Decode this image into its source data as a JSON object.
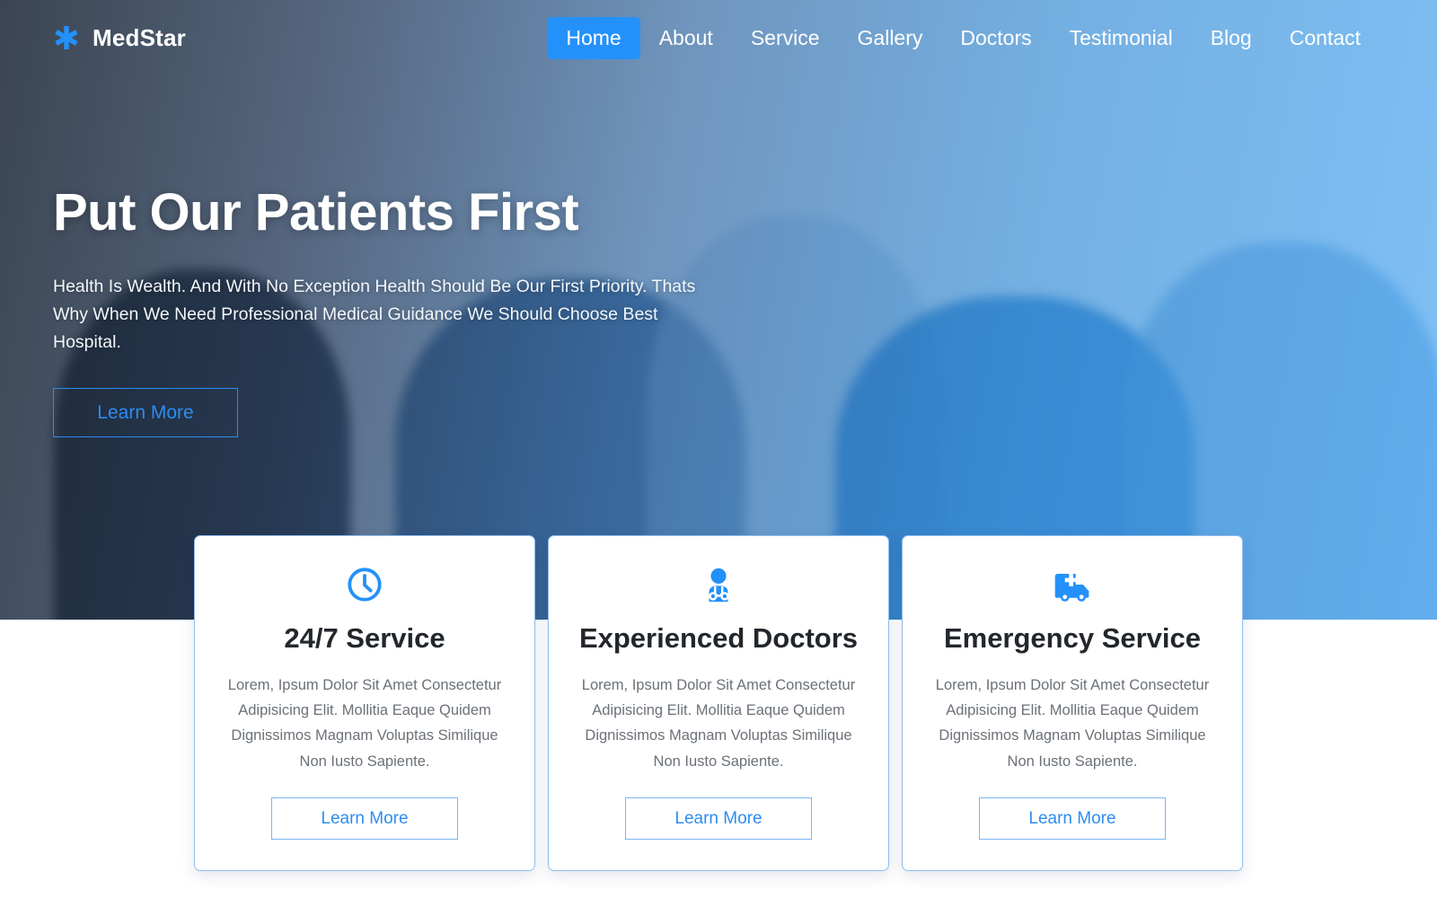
{
  "brand": {
    "name": "MedStar",
    "icon": "asterisk-star-of-life-icon",
    "color": "#2491fa"
  },
  "nav": {
    "items": [
      {
        "label": "Home",
        "active": true
      },
      {
        "label": "About",
        "active": false
      },
      {
        "label": "Service",
        "active": false
      },
      {
        "label": "Gallery",
        "active": false
      },
      {
        "label": "Doctors",
        "active": false
      },
      {
        "label": "Testimonial",
        "active": false
      },
      {
        "label": "Blog",
        "active": false
      },
      {
        "label": "Contact",
        "active": false
      }
    ],
    "active_bg": "#2491fa"
  },
  "hero": {
    "title": "Put Our Patients First",
    "text": "Health Is Wealth. And With No Exception Health Should Be Our First Priority. Thats Why When We Need Professional Medical Guidance We Should Choose Best Hospital.",
    "button_label": "Learn More",
    "accent": "#2d8cf0"
  },
  "cards": [
    {
      "icon": "clock-icon",
      "title": "24/7 Service",
      "text": "Lorem, Ipsum Dolor Sit Amet Consectetur Adipisicing Elit. Mollitia Eaque Quidem Dignissimos Magnam Voluptas Similique Non Iusto Sapiente.",
      "button_label": "Learn More"
    },
    {
      "icon": "doctor-stethoscope-icon",
      "title": "Experienced Doctors",
      "text": "Lorem, Ipsum Dolor Sit Amet Consectetur Adipisicing Elit. Mollitia Eaque Quidem Dignissimos Magnam Voluptas Similique Non Iusto Sapiente.",
      "button_label": "Learn More"
    },
    {
      "icon": "ambulance-icon",
      "title": "Emergency Service",
      "text": "Lorem, Ipsum Dolor Sit Amet Consectetur Adipisicing Elit. Mollitia Eaque Quidem Dignissimos Magnam Voluptas Similique Non Iusto Sapiente.",
      "button_label": "Learn More"
    }
  ]
}
